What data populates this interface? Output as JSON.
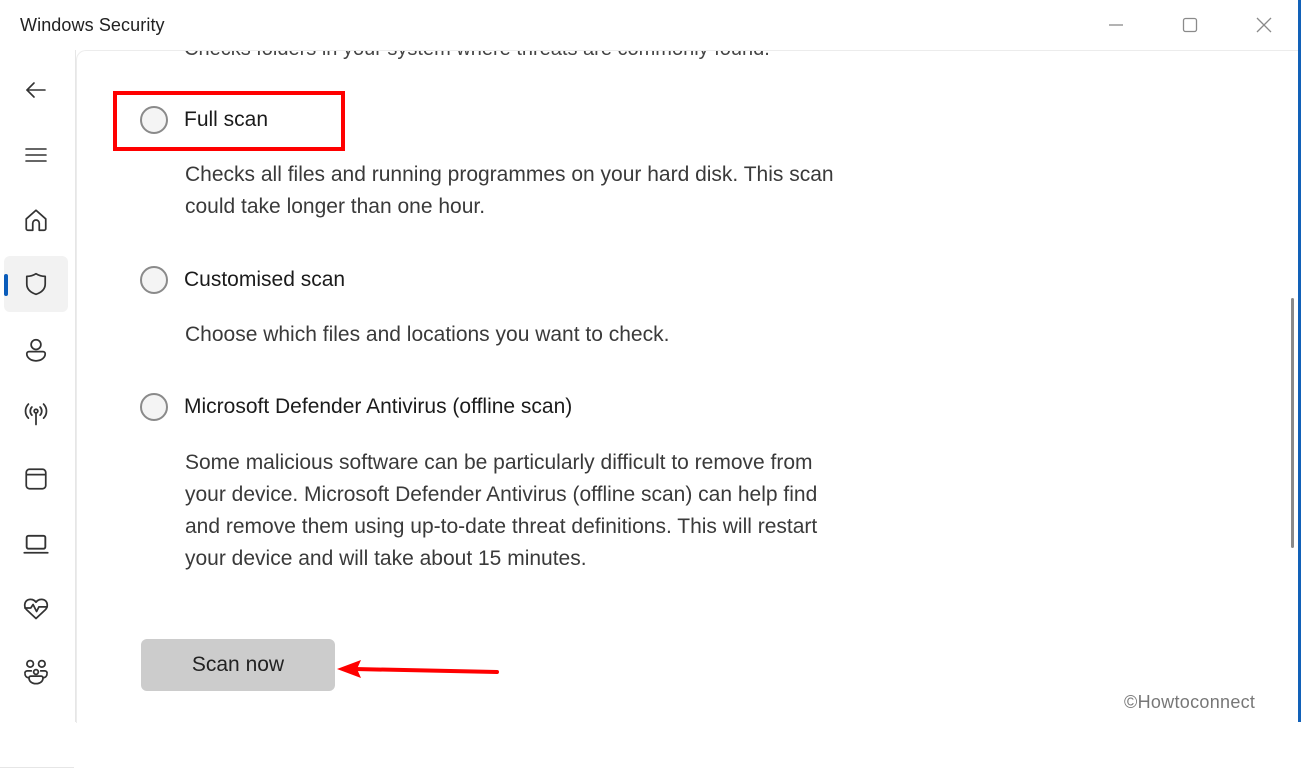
{
  "window": {
    "title": "Windows Security",
    "controls": {
      "minimize_icon": "minimize-icon",
      "maximize_icon": "maximize-icon",
      "close_icon": "close-icon"
    }
  },
  "sidebar": {
    "items": [
      {
        "name": "back",
        "icon": "arrow-left-icon",
        "active": false
      },
      {
        "name": "menu",
        "icon": "hamburger-menu-icon",
        "active": false
      },
      {
        "name": "home",
        "icon": "home-icon",
        "active": false
      },
      {
        "name": "virus-threat-protection",
        "icon": "shield-icon",
        "active": true
      },
      {
        "name": "account-protection",
        "icon": "person-icon",
        "active": false
      },
      {
        "name": "firewall-network-protection",
        "icon": "antenna-icon",
        "active": false
      },
      {
        "name": "app-browser-control",
        "icon": "browser-window-icon",
        "active": false
      },
      {
        "name": "device-security",
        "icon": "laptop-icon",
        "active": false
      },
      {
        "name": "device-performance-health",
        "icon": "heart-pulse-icon",
        "active": false
      },
      {
        "name": "family-options",
        "icon": "family-icon",
        "active": false
      }
    ],
    "accent_color": "#0a5cba"
  },
  "content": {
    "scrolled_partial_text": "Checks folders in your system where threats are commonly found.",
    "options": [
      {
        "label": "Full scan",
        "selected": false,
        "description": [
          "Checks all files and running programmes on your hard disk. This scan",
          "could take longer than one hour."
        ]
      },
      {
        "label": "Customised scan",
        "selected": false,
        "description": [
          "Choose which files and locations you want to check."
        ]
      },
      {
        "label": "Microsoft Defender Antivirus (offline scan)",
        "selected": false,
        "description": [
          "Some malicious software can be particularly difficult to remove from",
          "your device. Microsoft Defender Antivirus (offline scan) can help find",
          "and remove them using up-to-date threat definitions. This will restart",
          "your device and will take about 15 minutes."
        ]
      }
    ],
    "scan_button_label": "Scan now"
  },
  "annotations": {
    "highlight_color": "#ff0000",
    "highlight_target": "Full scan",
    "arrow_target": "Scan now"
  },
  "watermark": "©Howtoconnect"
}
